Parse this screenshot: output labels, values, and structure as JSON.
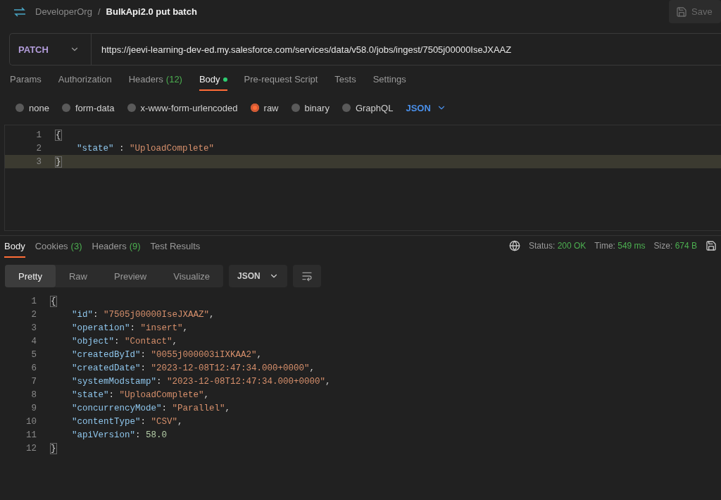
{
  "header": {
    "breadcrumb": "DeveloperOrg",
    "separator": "/",
    "title": "BulkApi2.0 put batch",
    "save": "Save"
  },
  "request": {
    "method": "PATCH",
    "url": "https://jeevi-learning-dev-ed.my.salesforce.com/services/data/v58.0/jobs/ingest/7505j00000IseJXAAZ"
  },
  "request_tabs": [
    {
      "label": "Params",
      "selected": false,
      "dot": false
    },
    {
      "label": "Authorization",
      "selected": false,
      "dot": false
    },
    {
      "label": "Headers",
      "count": "(12)",
      "selected": false,
      "dot": false
    },
    {
      "label": "Body",
      "selected": true,
      "dot": true
    },
    {
      "label": "Pre-request Script",
      "selected": false,
      "dot": false
    },
    {
      "label": "Tests",
      "selected": false,
      "dot": false
    },
    {
      "label": "Settings",
      "selected": false,
      "dot": false
    }
  ],
  "body_types": [
    {
      "label": "none",
      "selected": false
    },
    {
      "label": "form-data",
      "selected": false
    },
    {
      "label": "x-www-form-urlencoded",
      "selected": false
    },
    {
      "label": "raw",
      "selected": true
    },
    {
      "label": "binary",
      "selected": false
    },
    {
      "label": "GraphQL",
      "selected": false
    }
  ],
  "body_format": "JSON",
  "request_editor": {
    "lines": [
      {
        "number": "1",
        "indented": false,
        "highlighted": false,
        "tokens": [
          {
            "kind": "bracket",
            "text": "{"
          }
        ]
      },
      {
        "number": "2",
        "indented": true,
        "highlighted": false,
        "tokens": [
          {
            "kind": "key",
            "text": "\"state\""
          },
          {
            "kind": "punct",
            "text": " : "
          },
          {
            "kind": "string",
            "text": "\"UploadComplete\""
          }
        ]
      },
      {
        "number": "3",
        "indented": false,
        "highlighted": true,
        "tokens": [
          {
            "kind": "bracket",
            "text": "}"
          }
        ]
      }
    ]
  },
  "response_tabs": [
    {
      "label": "Body",
      "selected": true
    },
    {
      "label": "Cookies",
      "count": "(3)",
      "selected": false
    },
    {
      "label": "Headers",
      "count": "(9)",
      "selected": false
    },
    {
      "label": "Test Results",
      "selected": false
    }
  ],
  "response_status": [
    {
      "label": "Status:",
      "value": "200 OK"
    },
    {
      "label": "Time:",
      "value": "549 ms"
    },
    {
      "label": "Size:",
      "value": "674 B"
    }
  ],
  "view_modes": [
    {
      "label": "Pretty",
      "selected": true
    },
    {
      "label": "Raw",
      "selected": false
    },
    {
      "label": "Preview",
      "selected": false
    },
    {
      "label": "Visualize",
      "selected": false
    }
  ],
  "response_format": "JSON",
  "response_editor": {
    "lines": [
      {
        "number": "1",
        "indented": false,
        "highlighted": false,
        "tokens": [
          {
            "kind": "bracket",
            "text": "{"
          }
        ]
      },
      {
        "number": "2",
        "indented": true,
        "highlighted": false,
        "tokens": [
          {
            "kind": "key",
            "text": "\"id\""
          },
          {
            "kind": "punct",
            "text": ": "
          },
          {
            "kind": "string",
            "text": "\"7505j00000IseJXAAZ\""
          },
          {
            "kind": "punct",
            "text": ","
          }
        ]
      },
      {
        "number": "3",
        "indented": true,
        "highlighted": false,
        "tokens": [
          {
            "kind": "key",
            "text": "\"operation\""
          },
          {
            "kind": "punct",
            "text": ": "
          },
          {
            "kind": "string",
            "text": "\"insert\""
          },
          {
            "kind": "punct",
            "text": ","
          }
        ]
      },
      {
        "number": "4",
        "indented": true,
        "highlighted": false,
        "tokens": [
          {
            "kind": "key",
            "text": "\"object\""
          },
          {
            "kind": "punct",
            "text": ": "
          },
          {
            "kind": "string",
            "text": "\"Contact\""
          },
          {
            "kind": "punct",
            "text": ","
          }
        ]
      },
      {
        "number": "5",
        "indented": true,
        "highlighted": false,
        "tokens": [
          {
            "kind": "key",
            "text": "\"createdById\""
          },
          {
            "kind": "punct",
            "text": ": "
          },
          {
            "kind": "string",
            "text": "\"0055j000003iIXKAA2\""
          },
          {
            "kind": "punct",
            "text": ","
          }
        ]
      },
      {
        "number": "6",
        "indented": true,
        "highlighted": false,
        "tokens": [
          {
            "kind": "key",
            "text": "\"createdDate\""
          },
          {
            "kind": "punct",
            "text": ": "
          },
          {
            "kind": "string",
            "text": "\"2023-12-08T12:47:34.000+0000\""
          },
          {
            "kind": "punct",
            "text": ","
          }
        ]
      },
      {
        "number": "7",
        "indented": true,
        "highlighted": false,
        "tokens": [
          {
            "kind": "key",
            "text": "\"systemModstamp\""
          },
          {
            "kind": "punct",
            "text": ": "
          },
          {
            "kind": "string",
            "text": "\"2023-12-08T12:47:34.000+0000\""
          },
          {
            "kind": "punct",
            "text": ","
          }
        ]
      },
      {
        "number": "8",
        "indented": true,
        "highlighted": false,
        "tokens": [
          {
            "kind": "key",
            "text": "\"state\""
          },
          {
            "kind": "punct",
            "text": ": "
          },
          {
            "kind": "string",
            "text": "\"UploadComplete\""
          },
          {
            "kind": "punct",
            "text": ","
          }
        ]
      },
      {
        "number": "9",
        "indented": true,
        "highlighted": false,
        "tokens": [
          {
            "kind": "key",
            "text": "\"concurrencyMode\""
          },
          {
            "kind": "punct",
            "text": ": "
          },
          {
            "kind": "string",
            "text": "\"Parallel\""
          },
          {
            "kind": "punct",
            "text": ","
          }
        ]
      },
      {
        "number": "10",
        "indented": true,
        "highlighted": false,
        "tokens": [
          {
            "kind": "key",
            "text": "\"contentType\""
          },
          {
            "kind": "punct",
            "text": ": "
          },
          {
            "kind": "string",
            "text": "\"CSV\""
          },
          {
            "kind": "punct",
            "text": ","
          }
        ]
      },
      {
        "number": "11",
        "indented": true,
        "highlighted": false,
        "tokens": [
          {
            "kind": "key",
            "text": "\"apiVersion\""
          },
          {
            "kind": "punct",
            "text": ": "
          },
          {
            "kind": "number",
            "text": "58.0"
          }
        ]
      },
      {
        "number": "12",
        "indented": false,
        "highlighted": false,
        "tokens": [
          {
            "kind": "bracket",
            "text": "}"
          }
        ]
      }
    ]
  }
}
